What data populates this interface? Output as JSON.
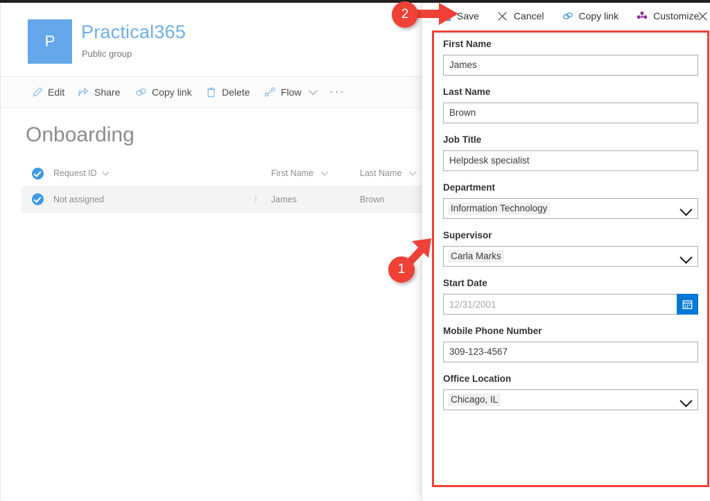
{
  "site": {
    "logo_letter": "P",
    "title": "Practical365",
    "subtitle": "Public group",
    "logo_color": "#64a8eb",
    "title_color": "#71afe5"
  },
  "command_bar": {
    "items": [
      {
        "label": "Edit",
        "icon": "pencil-icon",
        "has_chevron": false
      },
      {
        "label": "Share",
        "icon": "share-icon",
        "has_chevron": false
      },
      {
        "label": "Copy link",
        "icon": "link-icon",
        "has_chevron": false
      },
      {
        "label": "Delete",
        "icon": "trash-icon",
        "has_chevron": false
      },
      {
        "label": "Flow",
        "icon": "flow-icon",
        "has_chevron": true
      }
    ],
    "overflow_label": "···"
  },
  "list": {
    "title": "Onboarding",
    "columns": [
      "Request ID",
      "First Name",
      "Last Name"
    ],
    "rows": [
      {
        "request_id": "Not assigned",
        "first_name": "James",
        "last_name": "Brown",
        "selected": true
      }
    ],
    "header_selected": true
  },
  "panel": {
    "commands": [
      {
        "label": "Save",
        "icon": "save-icon"
      },
      {
        "label": "Cancel",
        "icon": "close-icon"
      },
      {
        "label": "Copy link",
        "icon": "link-icon"
      },
      {
        "label": "Customize",
        "icon": "powerapps-icon"
      }
    ],
    "close_icon": "close-icon",
    "fields": [
      {
        "label": "First Name",
        "value": "James",
        "type": "text",
        "placeholder": ""
      },
      {
        "label": "Last Name",
        "value": "Brown",
        "type": "text",
        "placeholder": ""
      },
      {
        "label": "Job Title",
        "value": "Helpdesk specialist",
        "type": "text",
        "placeholder": ""
      },
      {
        "label": "Department",
        "value": "Information Technology",
        "type": "select",
        "placeholder": ""
      },
      {
        "label": "Supervisor",
        "value": "Carla Marks",
        "type": "select",
        "placeholder": ""
      },
      {
        "label": "Start Date",
        "value": "",
        "type": "date",
        "placeholder": "12/31/2001"
      },
      {
        "label": "Mobile Phone Number",
        "value": "309-123-4567",
        "type": "text",
        "placeholder": ""
      },
      {
        "label": "Office Location",
        "value": "Chicago, IL",
        "type": "select",
        "placeholder": ""
      }
    ]
  },
  "annotations": {
    "accent_color": "#ef4136",
    "markers": [
      {
        "number": "1",
        "direction": "up-right"
      },
      {
        "number": "2",
        "direction": "right"
      }
    ]
  }
}
